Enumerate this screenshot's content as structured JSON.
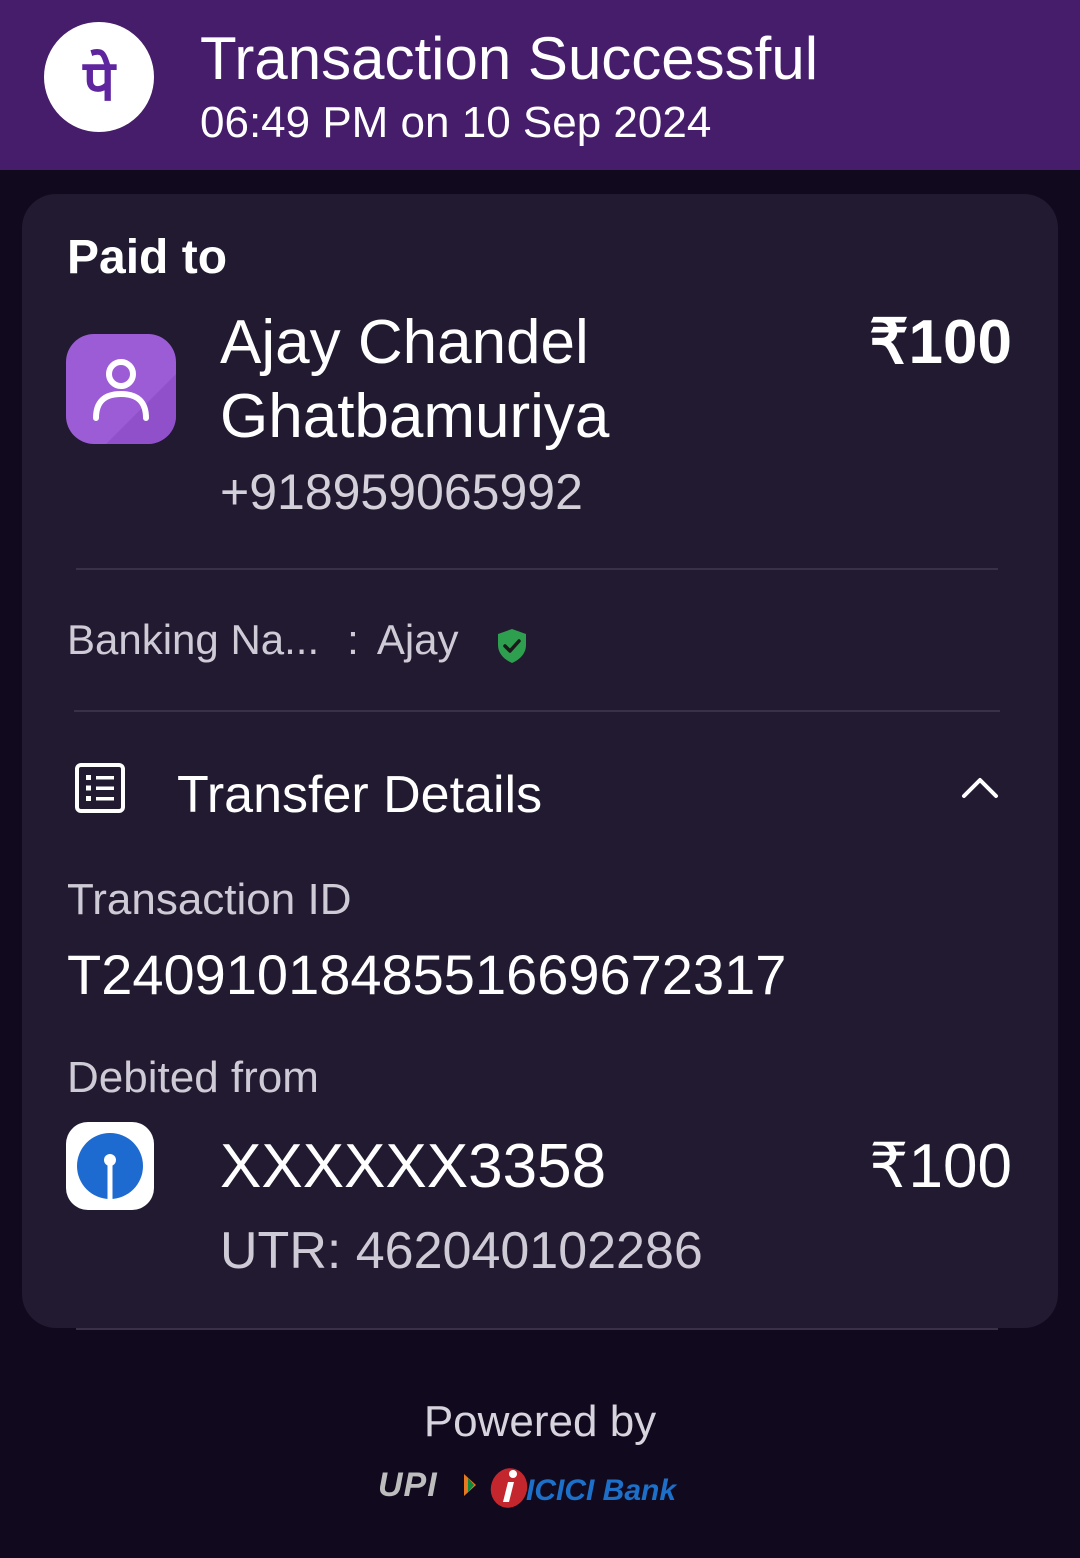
{
  "header": {
    "title": "Transaction Successful",
    "subtitle": "06:49 PM on 10 Sep 2024",
    "logo_glyph": "पे",
    "logo_icon": "phonepe-logo-icon"
  },
  "paid_to": {
    "label": "Paid to",
    "name_line1": "Ajay Chandel",
    "name_line2": "Ghatbamuriya",
    "phone": "+918959065992",
    "amount": "₹100",
    "avatar_icon": "person-icon",
    "avatar_color": "#9c5cd6"
  },
  "banking_name": {
    "label": "Banking Na...",
    "separator": ":",
    "value": "Ajay",
    "verified_icon": "shield-check-icon",
    "verified_color": "#2e9e4f"
  },
  "transfer_details": {
    "title": "Transfer Details",
    "icon": "receipt-list-icon",
    "toggle_icon": "chevron-up-icon",
    "transaction_id_label": "Transaction ID",
    "transaction_id": "T2409101848551669672317",
    "debited_from_label": "Debited from",
    "account": "XXXXXX3358",
    "amount": "₹100",
    "utr": "UTR: 462040102286",
    "bank_icon": "sbi-bank-logo-icon"
  },
  "footer": {
    "powered_by": "Powered by",
    "upi_logo_text": "UPI",
    "icici_logo_text": "ICICI Bank"
  },
  "colors": {
    "header_bg": "#451d6a",
    "card_bg": "#221a30",
    "page_bg": "#110a1e",
    "brand_purple": "#5f259f"
  }
}
